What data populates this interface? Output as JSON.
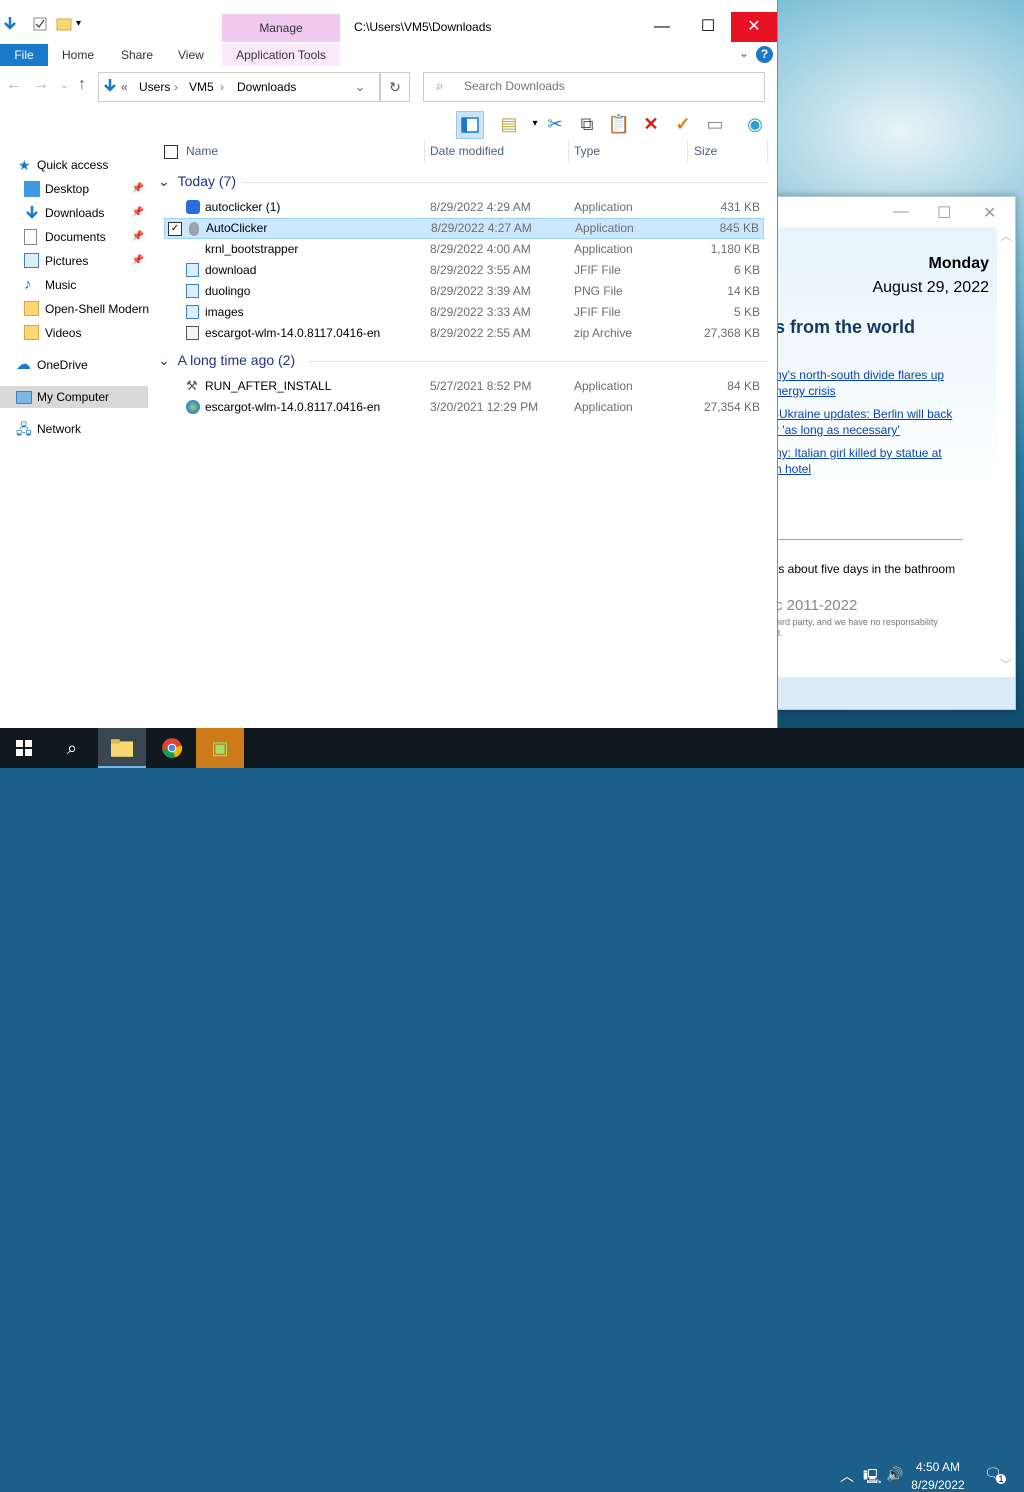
{
  "window": {
    "path_title": "C:\\Users\\VM5\\Downloads",
    "manage_tab": "Manage",
    "ribbon_tabs": [
      "File",
      "Home",
      "Share",
      "View",
      "Application Tools"
    ],
    "help_label": "?"
  },
  "address": {
    "prefix": "«",
    "segments": [
      "Users",
      "VM5",
      "Downloads"
    ],
    "search_placeholder": "Search Downloads"
  },
  "nav": {
    "items": [
      {
        "label": "Quick access"
      },
      {
        "label": "Desktop"
      },
      {
        "label": "Downloads"
      },
      {
        "label": "Documents"
      },
      {
        "label": "Pictures"
      },
      {
        "label": "Music"
      },
      {
        "label": "Open-Shell Modern"
      },
      {
        "label": "Videos"
      },
      {
        "label": "OneDrive"
      },
      {
        "label": "My Computer"
      },
      {
        "label": "Network"
      }
    ]
  },
  "columns": {
    "name": "Name",
    "date": "Date modified",
    "type": "Type",
    "size": "Size"
  },
  "groups": [
    {
      "label": "Today (7)",
      "files": [
        {
          "name": "autoclicker (1)",
          "date": "8/29/2022 4:29 AM",
          "type": "Application",
          "size": "431 KB",
          "icon": "app-blue-icon"
        },
        {
          "name": "AutoClicker",
          "date": "8/29/2022 4:27 AM",
          "type": "Application",
          "size": "845 KB",
          "icon": "mouse-icon",
          "selected": true
        },
        {
          "name": "krnl_bootstrapper",
          "date": "8/29/2022 4:00 AM",
          "type": "Application",
          "size": "1,180 KB",
          "icon": "blank-icon"
        },
        {
          "name": "download",
          "date": "8/29/2022 3:55 AM",
          "type": "JFIF File",
          "size": "6 KB",
          "icon": "image-icon"
        },
        {
          "name": "duolingo",
          "date": "8/29/2022 3:39 AM",
          "type": "PNG File",
          "size": "14 KB",
          "icon": "image-icon"
        },
        {
          "name": "images",
          "date": "8/29/2022 3:33 AM",
          "type": "JFIF File",
          "size": "5 KB",
          "icon": "image-icon"
        },
        {
          "name": "escargot-wlm-14.0.8117.0416-en",
          "date": "8/29/2022 2:55 AM",
          "type": "zip Archive",
          "size": "27,368 KB",
          "icon": "zip-icon"
        }
      ]
    },
    {
      "label": "A long time ago (2)",
      "files": [
        {
          "name": "RUN_AFTER_INSTALL",
          "date": "5/27/2021 8:52 PM",
          "type": "Application",
          "size": "84 KB",
          "icon": "tools-icon"
        },
        {
          "name": "escargot-wlm-14.0.8117.0416-en",
          "date": "3/20/2021 12:29 PM",
          "type": "Application",
          "size": "27,354 KB",
          "icon": "globe-icon"
        }
      ]
    }
  ],
  "news": {
    "day": "Monday",
    "date": "August 29, 2022",
    "heading": "s from the world",
    "links": [
      "ny's north-south divide flares up\nnergy crisis",
      "-Ukraine updates: Berlin will back\nr 'as long as necessary'",
      "ny: Italian girl killed by statue at\nh hotel"
    ],
    "text": "ts about five days in the bathroom",
    "copyright": "c 2011-2022",
    "small": "hird party, and we have no responsability\nd."
  },
  "taskbar": {
    "time": "4:50 AM",
    "date": "8/29/2022",
    "notification_count": "1"
  },
  "colors": {
    "accent": "#1979ca",
    "close": "#e81123",
    "selection": "#cce8ff",
    "manage_tab": "#f1c8ef",
    "group_header": "#1e3287"
  }
}
